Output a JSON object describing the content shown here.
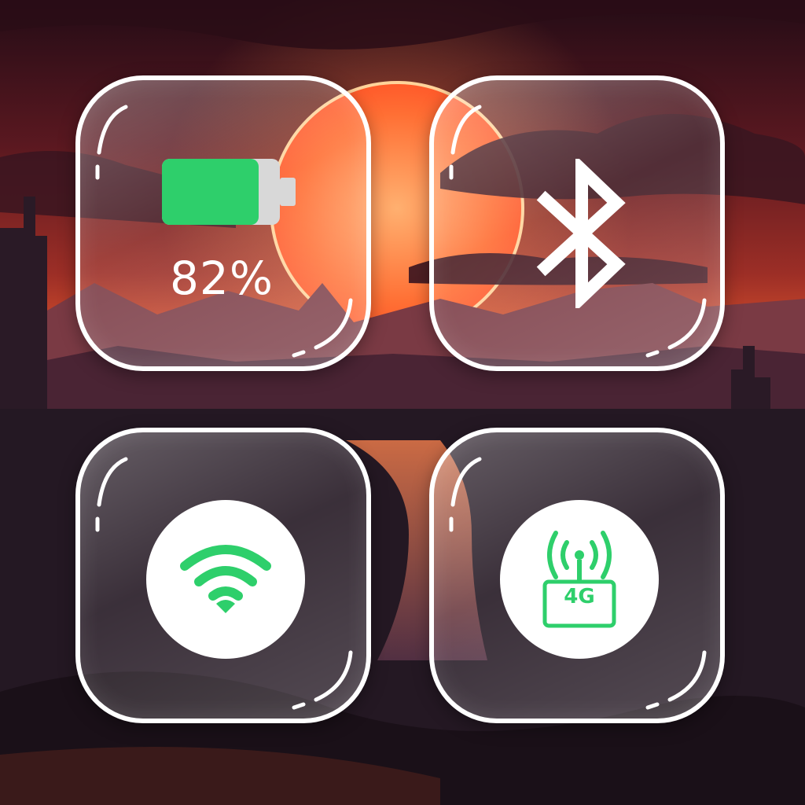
{
  "colors": {
    "accent_green": "#2ecf6b",
    "tile_border": "#ffffff",
    "sky_top": "#2a0f1a",
    "sun": "#ff7b3a"
  },
  "tiles": {
    "battery": {
      "icon": "battery-icon",
      "level": 0.82,
      "percent_label": "82%"
    },
    "bluetooth": {
      "icon": "bluetooth-icon"
    },
    "wifi": {
      "icon": "wifi-icon"
    },
    "cellular": {
      "icon": "cell-tower-icon",
      "network_label": "4G"
    }
  }
}
